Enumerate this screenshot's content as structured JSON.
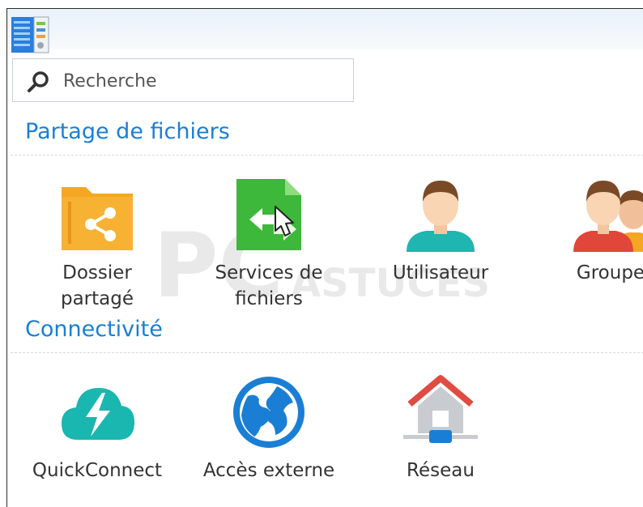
{
  "search": {
    "placeholder": "Recherche"
  },
  "sections": [
    {
      "title": "Partage de fichiers",
      "items": [
        {
          "label": "Dossier\npartagé",
          "icon": "shared-folder-icon"
        },
        {
          "label": "Services de\nfichiers",
          "icon": "file-services-icon"
        },
        {
          "label": "Utilisateur",
          "icon": "user-icon"
        },
        {
          "label": "Groupe",
          "icon": "group-icon"
        }
      ]
    },
    {
      "title": "Connectivité",
      "items": [
        {
          "label": "QuickConnect",
          "icon": "quickconnect-icon"
        },
        {
          "label": "Accès externe",
          "icon": "external-access-icon"
        },
        {
          "label": "Réseau",
          "icon": "network-icon"
        }
      ]
    }
  ],
  "watermark": {
    "text_main": "PC",
    "text_sub": "ASTUCES"
  },
  "colors": {
    "accent": "#1a7fd4",
    "folder": "#f5a623",
    "file_services": "#3db83a",
    "user_shirt": "#1fb5b0",
    "group_shirt": "#e0463a",
    "quickconnect": "#19b7b0",
    "globe": "#1a7fd4",
    "network_roof": "#e14b42"
  }
}
